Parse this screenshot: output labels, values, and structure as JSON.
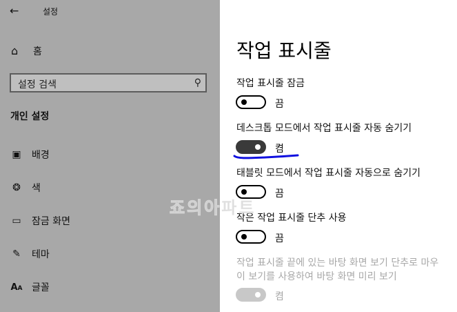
{
  "sidebar": {
    "back_icon": "back-arrow-icon",
    "title": "설정",
    "home": {
      "icon": "home-icon",
      "label": "홈"
    },
    "search": {
      "placeholder": "설정 검색",
      "icon": "search-icon"
    },
    "section": "개인 설정",
    "items": [
      {
        "icon": "picture-icon",
        "label": "배경"
      },
      {
        "icon": "palette-icon",
        "label": "색"
      },
      {
        "icon": "lock-screen-icon",
        "label": "잠금 화면"
      },
      {
        "icon": "theme-icon",
        "label": "테마"
      },
      {
        "icon": "font-icon",
        "label": "글꼴"
      }
    ],
    "background_color": "#a8a8a8"
  },
  "main": {
    "title": "작업 표시줄",
    "settings": [
      {
        "label": "작업 표시줄 잠금",
        "toggle": "off",
        "state": "끔",
        "enabled": true
      },
      {
        "label": "데스크톱 모드에서 작업 표시줄 자동 숨기기",
        "toggle": "on",
        "state": "켬",
        "enabled": true
      },
      {
        "label": "태블릿 모드에서 작업 표시줄 자동으로 숨기기",
        "toggle": "off",
        "state": "끔",
        "enabled": true
      },
      {
        "label": "작은 작업 표시줄 단추 사용",
        "toggle": "off",
        "state": "끔",
        "enabled": true
      },
      {
        "label_line1": "작업 표시줄 끝에 있는 바탕 화면 보기 단추로 마우",
        "label_line2": "이 보기를 사용하여 바탕 화면 미리 보기",
        "toggle": "on",
        "state": "켬",
        "enabled": false
      }
    ],
    "annotation_color": "#1010e0"
  },
  "watermark": "죠의아파트"
}
